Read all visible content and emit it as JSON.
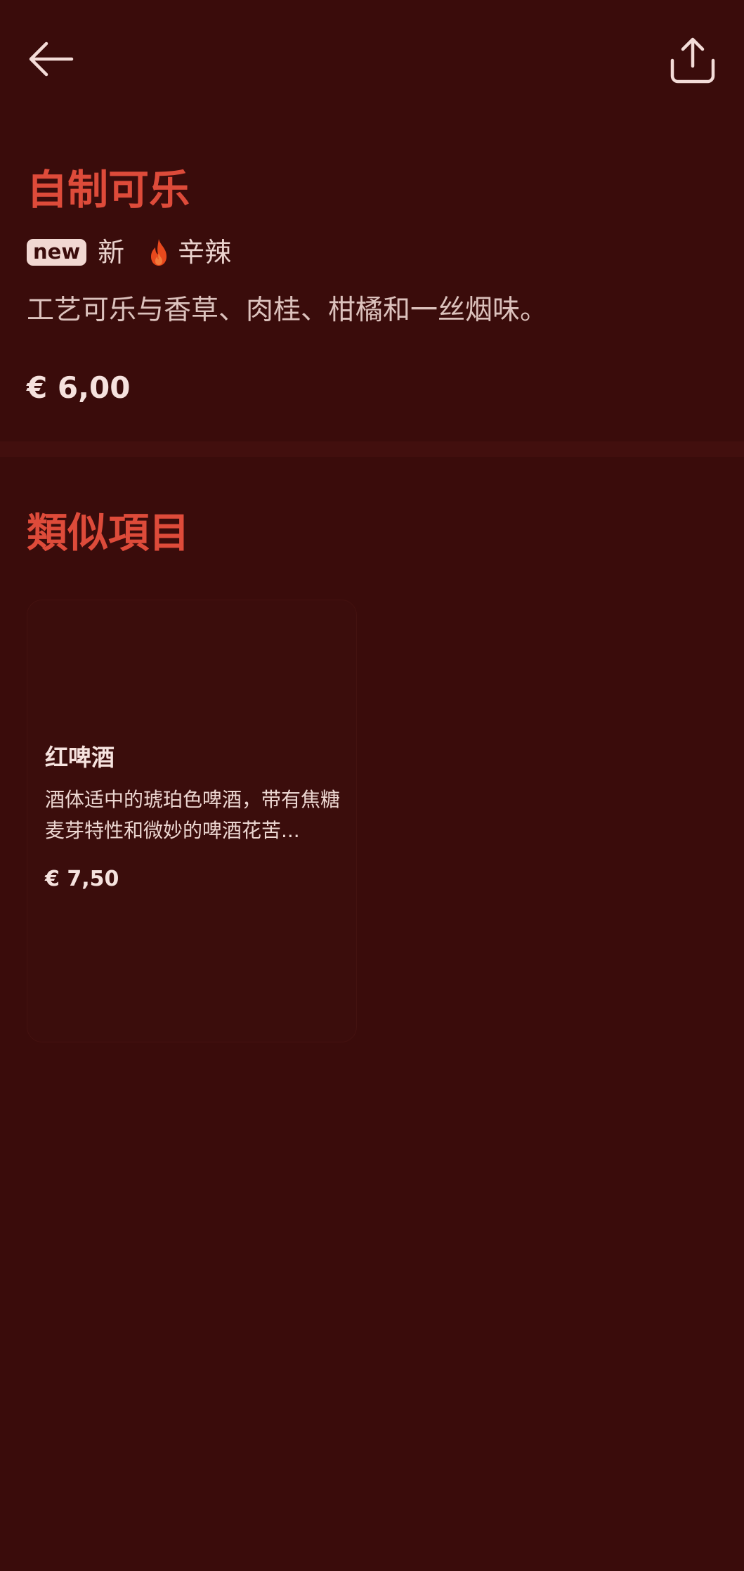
{
  "header": {
    "back_icon": "arrow-left-icon",
    "share_icon": "share-upload-icon"
  },
  "product": {
    "title": "自制可乐",
    "badge_new": "new",
    "tag_new_label": "新",
    "tag_spicy_icon": "flame-icon",
    "tag_spicy_label": "辛辣",
    "description": "工艺可乐与香草、肉桂、柑橘和一丝烟味。",
    "price": "€ 6,00"
  },
  "similar": {
    "section_title": "類似項目",
    "items": [
      {
        "name": "红啤酒",
        "description": "酒体适中的琥珀色啤酒，带有焦糖麦芽特性和微妙的啤酒花苦...",
        "price": "€ 7,50"
      }
    ]
  },
  "colors": {
    "background": "#3a0c0b",
    "accent": "#de4b3a",
    "text": "#f3dcd8",
    "flame": "#e8491d"
  }
}
